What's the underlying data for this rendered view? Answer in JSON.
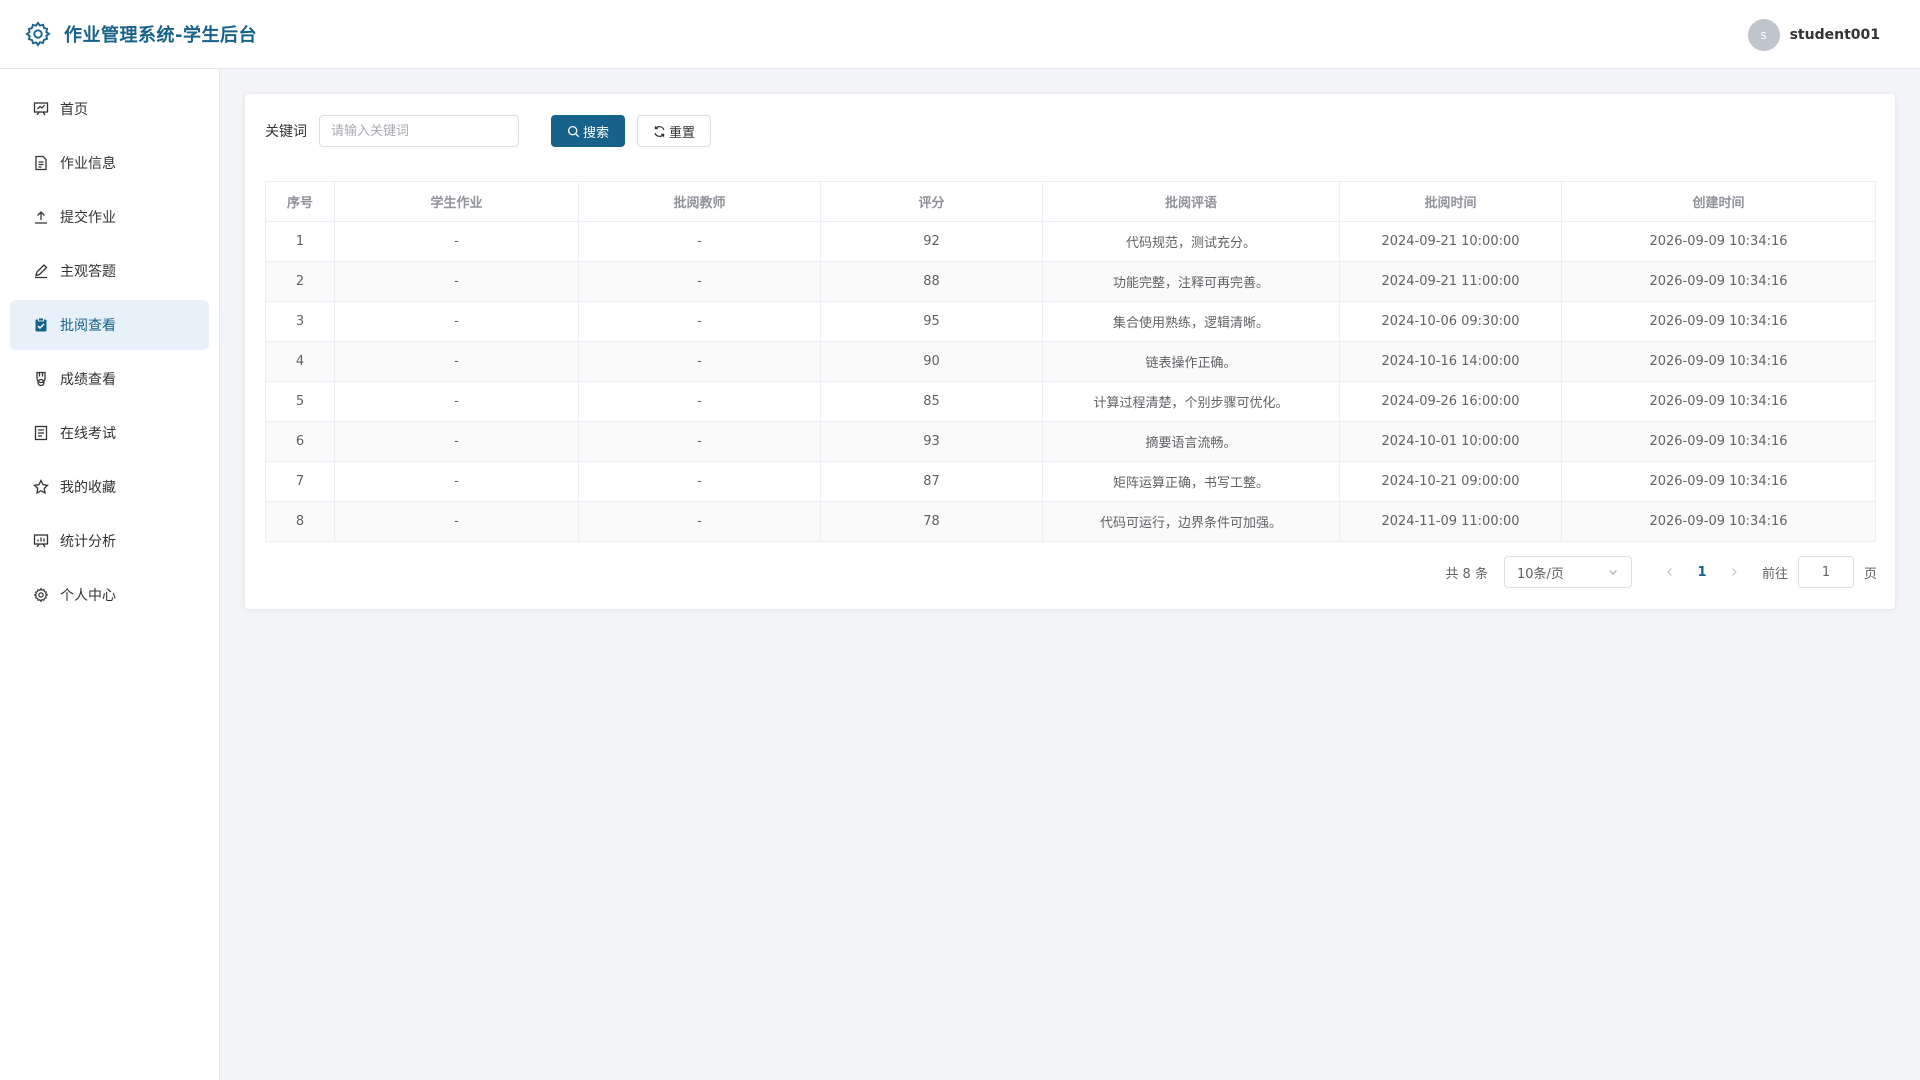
{
  "header": {
    "title": "作业管理系统-学生后台",
    "avatar_letter": "s",
    "username": "student001"
  },
  "sidebar": {
    "items": [
      {
        "label": "首页",
        "icon": "dashboard-icon"
      },
      {
        "label": "作业信息",
        "icon": "document-icon"
      },
      {
        "label": "提交作业",
        "icon": "upload-icon"
      },
      {
        "label": "主观答题",
        "icon": "edit-pen-icon"
      },
      {
        "label": "批阅查看",
        "icon": "checked-clipboard-icon",
        "active": true
      },
      {
        "label": "成绩查看",
        "icon": "medal-icon"
      },
      {
        "label": "在线考试",
        "icon": "tickets-icon"
      },
      {
        "label": "我的收藏",
        "icon": "star-icon"
      },
      {
        "label": "统计分析",
        "icon": "data-board-icon"
      },
      {
        "label": "个人中心",
        "icon": "setting-icon"
      }
    ]
  },
  "search": {
    "label": "关键词",
    "placeholder": "请输入关键词",
    "value": "",
    "search_button": "搜索",
    "reset_button": "重置"
  },
  "table": {
    "columns": [
      "序号",
      "学生作业",
      "批阅教师",
      "评分",
      "批阅评语",
      "批阅时间",
      "创建时间"
    ],
    "rows": [
      [
        "1",
        "-",
        "-",
        "92",
        "代码规范，测试充分。",
        "2024-09-21 10:00:00",
        "2026-09-09 10:34:16"
      ],
      [
        "2",
        "-",
        "-",
        "88",
        "功能完整，注释可再完善。",
        "2024-09-21 11:00:00",
        "2026-09-09 10:34:16"
      ],
      [
        "3",
        "-",
        "-",
        "95",
        "集合使用熟练，逻辑清晰。",
        "2024-10-06 09:30:00",
        "2026-09-09 10:34:16"
      ],
      [
        "4",
        "-",
        "-",
        "90",
        "链表操作正确。",
        "2024-10-16 14:00:00",
        "2026-09-09 10:34:16"
      ],
      [
        "5",
        "-",
        "-",
        "85",
        "计算过程清楚，个别步骤可优化。",
        "2024-09-26 16:00:00",
        "2026-09-09 10:34:16"
      ],
      [
        "6",
        "-",
        "-",
        "93",
        "摘要语言流畅。",
        "2024-10-01 10:00:00",
        "2026-09-09 10:34:16"
      ],
      [
        "7",
        "-",
        "-",
        "87",
        "矩阵运算正确，书写工整。",
        "2024-10-21 09:00:00",
        "2026-09-09 10:34:16"
      ],
      [
        "8",
        "-",
        "-",
        "78",
        "代码可运行，边界条件可加强。",
        "2024-11-09 11:00:00",
        "2026-09-09 10:34:16"
      ]
    ]
  },
  "pagination": {
    "total_text": "共 8 条",
    "page_size": "10条/页",
    "current_page": "1",
    "goto_label": "前往",
    "goto_value": "1",
    "page_unit": "页"
  },
  "colors": {
    "primary": "#17628a",
    "active_menu_bg": "#e8f1fa",
    "page_bg": "#f2f4f7"
  }
}
